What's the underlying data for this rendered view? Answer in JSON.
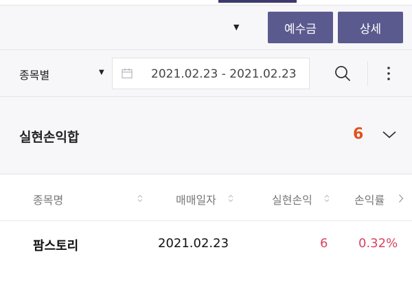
{
  "toolbar": {
    "deposit_label": "예수금",
    "detail_label": "상세"
  },
  "filter": {
    "selected": "종목별",
    "date_range": "2021.02.23  -  2021.02.23"
  },
  "summary": {
    "label": "실현손익합",
    "value": "6"
  },
  "table": {
    "headers": [
      "종목명",
      "매매일자",
      "실현손익",
      "손익률"
    ],
    "rows": [
      {
        "name": "팜스토리",
        "date": "2021.02.23",
        "realized_pl": "6",
        "rate": "0.32%"
      }
    ]
  },
  "colors": {
    "accent": "#5b5a8f",
    "summary_value": "#e0531d",
    "profit": "#d9435e"
  },
  "icons": [
    "dropdown-caret-icon",
    "calendar-icon",
    "search-icon",
    "more-vertical-icon",
    "chevron-down-icon",
    "sort-icon",
    "chevron-right-icon"
  ]
}
